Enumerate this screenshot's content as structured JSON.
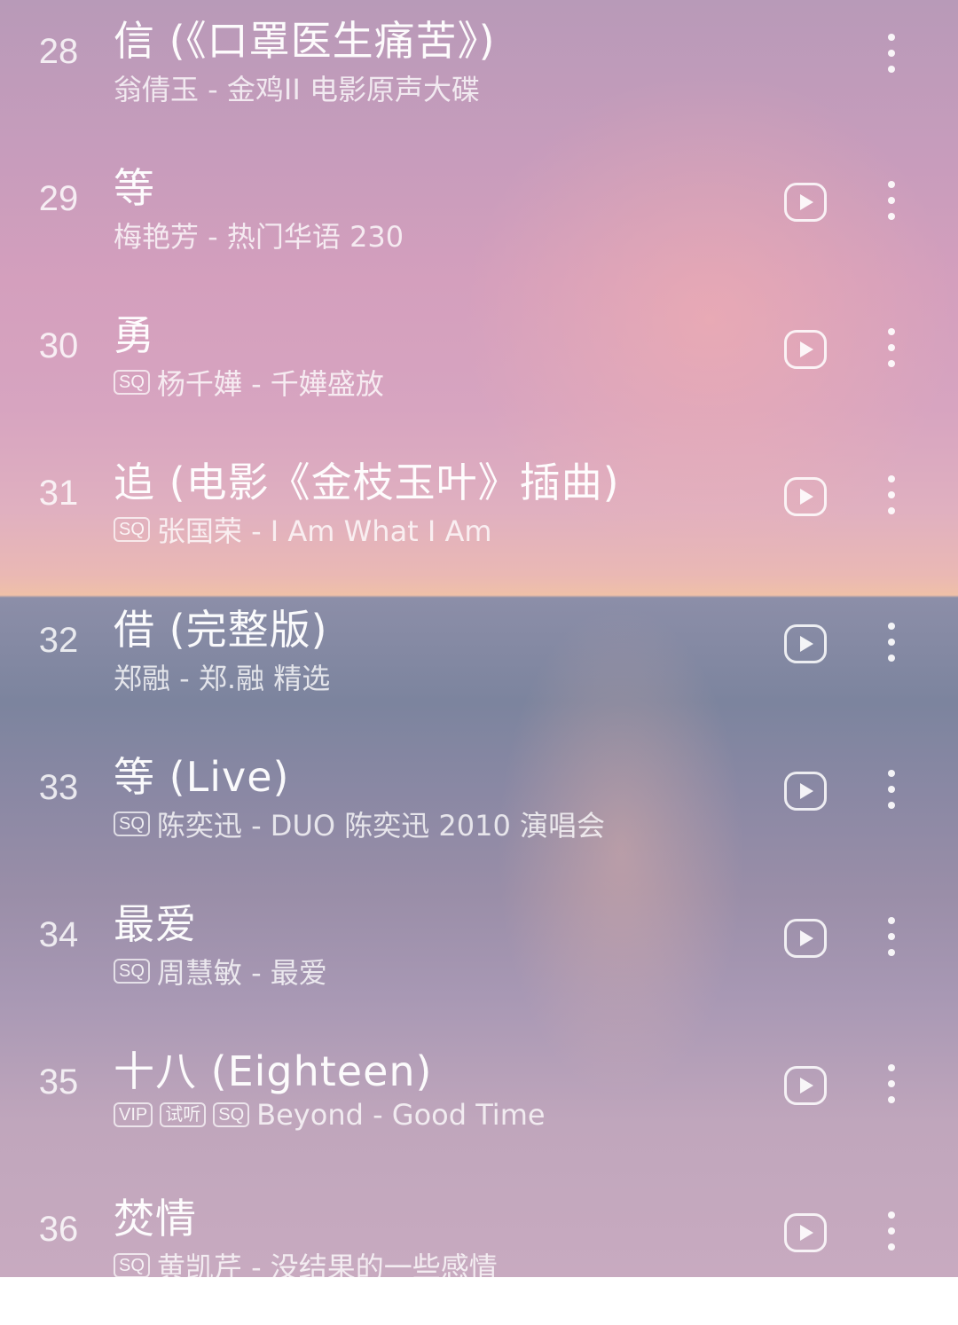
{
  "songs": [
    {
      "rank": "28",
      "title": "信 (《口罩医生痛苦》)",
      "badges": [],
      "subtitle": "翁倩玉 - 金鸡II 电影原声大碟",
      "has_play": false
    },
    {
      "rank": "29",
      "title": "等",
      "badges": [],
      "subtitle": "梅艳芳 - 热门华语 230",
      "has_play": true
    },
    {
      "rank": "30",
      "title": "勇",
      "badges": [
        "SQ"
      ],
      "subtitle": "杨千嬅 - 千嬅盛放",
      "has_play": true
    },
    {
      "rank": "31",
      "title": "追 (电影《金枝玉叶》插曲)",
      "badges": [
        "SQ"
      ],
      "subtitle": "张国荣 - I Am What I Am",
      "has_play": true
    },
    {
      "rank": "32",
      "title": "借 (完整版)",
      "badges": [],
      "subtitle": "郑融 - 郑.融 精选",
      "has_play": true
    },
    {
      "rank": "33",
      "title": "等 (Live)",
      "badges": [
        "SQ"
      ],
      "subtitle": "陈奕迅 - DUO 陈奕迅 2010 演唱会",
      "has_play": true
    },
    {
      "rank": "34",
      "title": "最爱",
      "badges": [
        "SQ"
      ],
      "subtitle": "周慧敏 - 最爱",
      "has_play": true
    },
    {
      "rank": "35",
      "title": "十八 (Eighteen)",
      "badges": [
        "VIP",
        "试听",
        "SQ"
      ],
      "subtitle": "Beyond - Good Time",
      "has_play": true
    },
    {
      "rank": "36",
      "title": "焚情",
      "badges": [
        "SQ"
      ],
      "subtitle": "黄凯芹 - 没结果的一些感情",
      "has_play": true
    }
  ],
  "icons": {
    "play": "play-icon",
    "more": "more-vertical-icon"
  }
}
